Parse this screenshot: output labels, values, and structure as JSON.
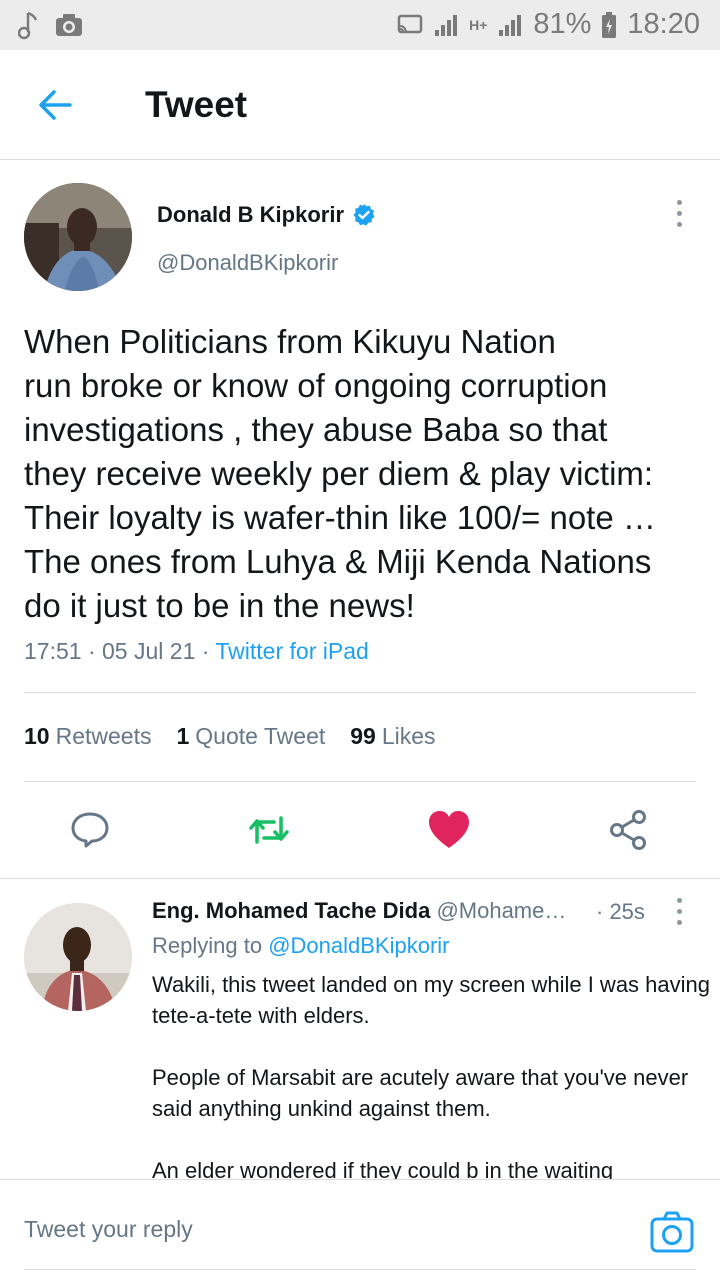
{
  "status_bar": {
    "battery": "81%",
    "time": "18:20",
    "network": "H+"
  },
  "header": {
    "title": "Tweet"
  },
  "tweet": {
    "author_name": "Donald B Kipkorir",
    "author_handle": "@DonaldBKipkorir",
    "text_lines": [
      "When Politicians from Kikuyu Nation",
      "run broke or know of ongoing corruption",
      "investigations , they abuse Baba so that",
      "they receive weekly per diem & play victim:",
      "Their loyalty is wafer-thin like 100/= note …",
      "The ones from Luhya & Miji Kenda Nations",
      "do it just to be in the news!"
    ],
    "time": "17:51",
    "date": "05 Jul 21",
    "source": "Twitter for iPad",
    "retweets_count": "10",
    "retweets_label": "Retweets",
    "quotes_count": "1",
    "quotes_label": "Quote Tweet",
    "likes_count": "99",
    "likes_label": "Likes",
    "colors": {
      "accent": "#1da1f2",
      "retweet": "#17bf63",
      "like": "#e0245e"
    }
  },
  "reply": {
    "author_name": "Eng. Mohamed Tache Dida",
    "author_handle": "@Mohame…",
    "time": "· 25s",
    "replying_label": "Replying to",
    "replying_to": "@DonaldBKipkorir",
    "paragraphs": [
      "Wakili, this tweet landed on my screen while I was having tete-a-tete with elders.",
      "People of Marsabit are acutely aware that you've never said anything unkind against them.",
      "An elder wondered if they could b in the waiting"
    ]
  },
  "composer": {
    "placeholder": "Tweet your reply"
  }
}
